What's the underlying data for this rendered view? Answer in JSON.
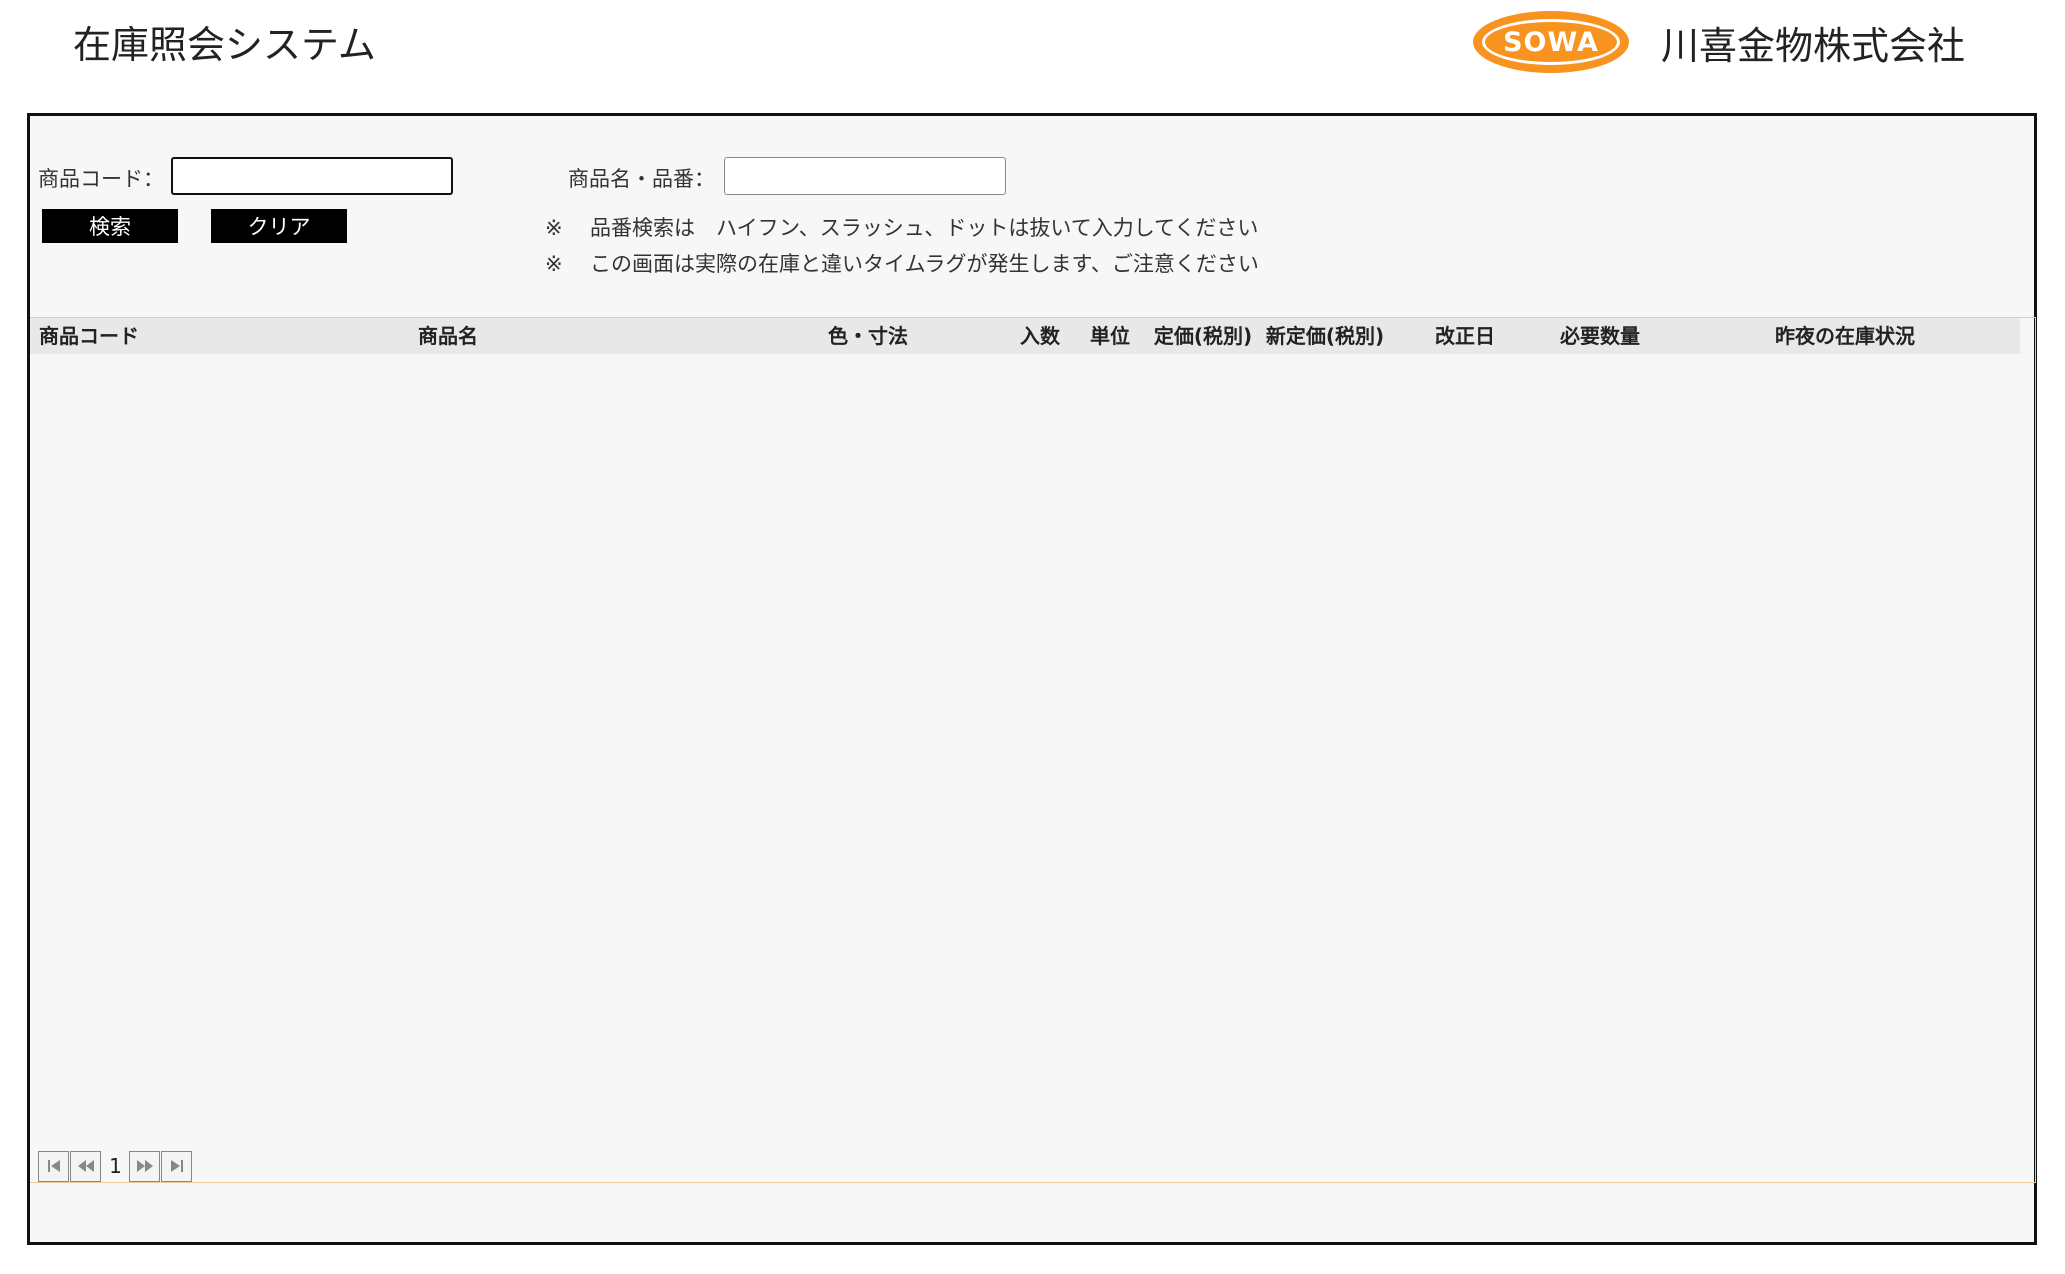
{
  "header": {
    "app_title": "在庫照会システム",
    "logo_text": "SOWA",
    "company_name": "川喜金物株式会社"
  },
  "search": {
    "code_label": "商品コード：",
    "code_value": "",
    "name_label": "商品名・品番：",
    "name_value": "",
    "search_button": "検索",
    "clear_button": "クリア",
    "notes": [
      {
        "mark": "※",
        "text": "品番検索は　ハイフン、スラッシュ、ドットは抜いて入力してください"
      },
      {
        "mark": "※",
        "text": "この画面は実際の在庫と違いタイムラグが発生します、ご注意ください"
      }
    ]
  },
  "table": {
    "columns": [
      "商品コード",
      "商品名",
      "色・寸法",
      "入数",
      "単位",
      "定価(税別)",
      "新定価(税別)",
      "改正日",
      "必要数量",
      "昨夜の在庫状況"
    ],
    "rows": []
  },
  "pager": {
    "current_page": "1",
    "icons": {
      "first": "first-page-icon",
      "prev": "prev-page-icon",
      "next": "next-page-icon",
      "last": "last-page-icon"
    }
  },
  "colors": {
    "logo_orange": "#f7931e",
    "button_bg": "#000000",
    "grid_border": "#f0c8a0",
    "header_bg": "#e8e8e8"
  }
}
